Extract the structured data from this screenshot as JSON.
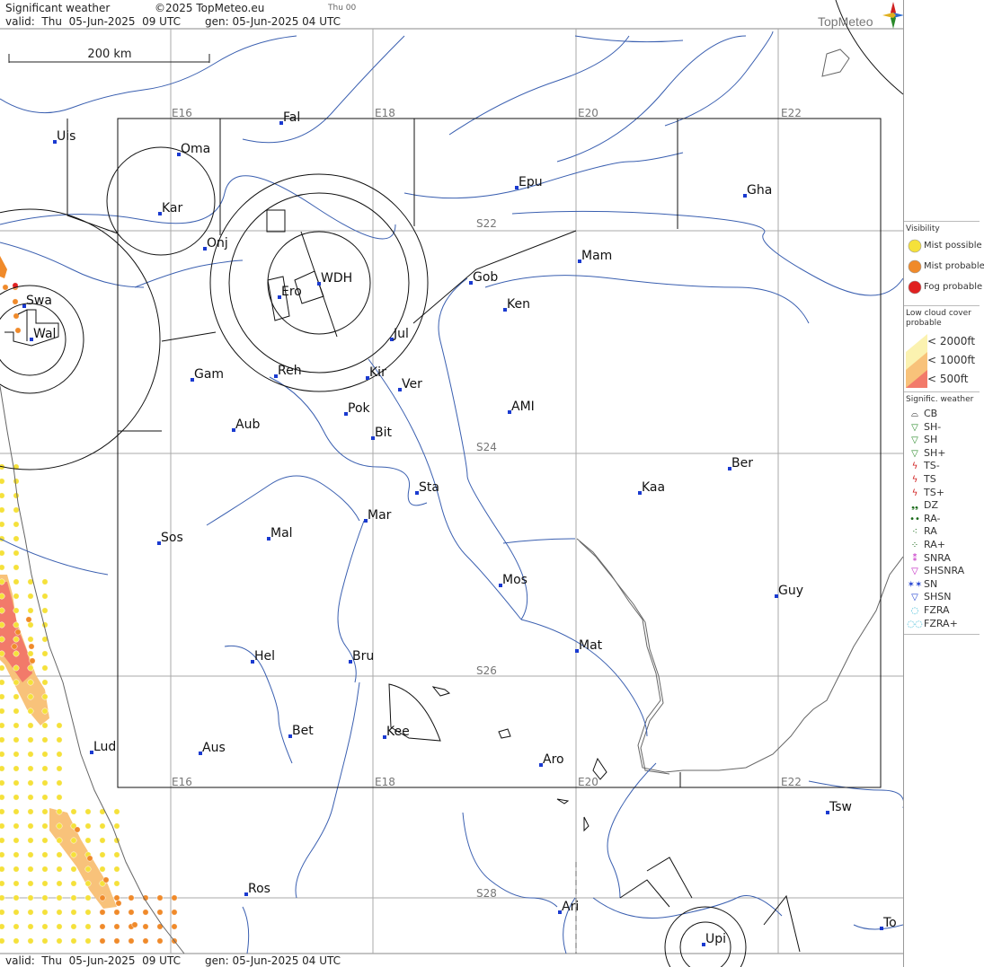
{
  "header": {
    "title": "Significant weather",
    "copyright": "©2025 TopMeteo.eu",
    "day_code": "Thu 00",
    "valid": "valid:  Thu  05-Jun-2025  09 UTC",
    "gen": "gen: 05-Jun-2025 04 UTC",
    "logo": "TopMeteo"
  },
  "footer": {
    "valid": "valid:  Thu  05-Jun-2025  09 UTC",
    "gen": "gen: 05-Jun-2025 04 UTC"
  },
  "scale_bar": {
    "label": "200 km"
  },
  "grid": {
    "lon_labels": [
      "E16",
      "E18",
      "E20",
      "E22"
    ],
    "lat_labels": [
      "S22",
      "S24",
      "S26",
      "S28"
    ]
  },
  "places": [
    {
      "name": "Uis"
    },
    {
      "name": "Fal"
    },
    {
      "name": "Oma"
    },
    {
      "name": "Kar"
    },
    {
      "name": "Epu"
    },
    {
      "name": "Gha"
    },
    {
      "name": "Onj"
    },
    {
      "name": "Mam"
    },
    {
      "name": "Gob"
    },
    {
      "name": "WDH"
    },
    {
      "name": "Swa"
    },
    {
      "name": "Ero"
    },
    {
      "name": "Ken"
    },
    {
      "name": "Wal"
    },
    {
      "name": "Jul"
    },
    {
      "name": "Gam"
    },
    {
      "name": "Reh"
    },
    {
      "name": "Kir"
    },
    {
      "name": "Ver"
    },
    {
      "name": "AMI"
    },
    {
      "name": "Pok"
    },
    {
      "name": "Aub"
    },
    {
      "name": "Bit"
    },
    {
      "name": "Ber"
    },
    {
      "name": "Sta"
    },
    {
      "name": "Kaa"
    },
    {
      "name": "Mar"
    },
    {
      "name": "Sos"
    },
    {
      "name": "Mal"
    },
    {
      "name": "Mos"
    },
    {
      "name": "Guy"
    },
    {
      "name": "Mat"
    },
    {
      "name": "Hel"
    },
    {
      "name": "Bru"
    },
    {
      "name": "Bet"
    },
    {
      "name": "Kee"
    },
    {
      "name": "Lud"
    },
    {
      "name": "Aus"
    },
    {
      "name": "Aro"
    },
    {
      "name": "Tsw"
    },
    {
      "name": "Ros"
    },
    {
      "name": "Ari"
    },
    {
      "name": "To"
    },
    {
      "name": "Upi"
    }
  ],
  "legend": {
    "visibility_title": "Visibility",
    "visibility": [
      {
        "label": "Mist possible",
        "icon": "mist-possible-icon",
        "color": "#f5e13a"
      },
      {
        "label": "Mist probable",
        "icon": "mist-probable-icon",
        "color": "#f08a2a"
      },
      {
        "label": "Fog probable",
        "icon": "fog-probable-icon",
        "color": "#e02020"
      }
    ],
    "low_cloud_title": "Low cloud cover probable",
    "low_cloud": [
      {
        "label": "< 2000ft",
        "color": "#fbf2b0"
      },
      {
        "label": "< 1000ft",
        "color": "#f8c27a"
      },
      {
        "label": "<   500ft",
        "color": "#f27a6a"
      }
    ],
    "sigwx_title": "Signific. weather",
    "sigwx": [
      {
        "label": "CB",
        "symbol": "⌓",
        "color": "#222222"
      },
      {
        "label": "SH-",
        "symbol": "▽",
        "color": "#2a8a2a"
      },
      {
        "label": "SH",
        "symbol": "▽",
        "color": "#2a8a2a"
      },
      {
        "label": "SH+",
        "symbol": "▽",
        "color": "#2a8a2a"
      },
      {
        "label": "TS-",
        "symbol": "ϟ",
        "color": "#d02020"
      },
      {
        "label": "TS",
        "symbol": "ϟ",
        "color": "#d02020"
      },
      {
        "label": "TS+",
        "symbol": "ϟ",
        "color": "#d02020"
      },
      {
        "label": "DZ",
        "symbol": "❟❟",
        "color": "#1a6a1a"
      },
      {
        "label": "RA-",
        "symbol": "••",
        "color": "#1a6a1a"
      },
      {
        "label": "RA",
        "symbol": "⁖",
        "color": "#1a6a1a"
      },
      {
        "label": "RA+",
        "symbol": "⁘",
        "color": "#1a6a1a"
      },
      {
        "label": "SNRA",
        "symbol": "⁑",
        "color": "#c020c0"
      },
      {
        "label": "SHSNRA",
        "symbol": "▽",
        "color": "#c020c0"
      },
      {
        "label": "SN",
        "symbol": "✶✶",
        "color": "#2040d0"
      },
      {
        "label": "SHSN",
        "symbol": "▽",
        "color": "#2040d0"
      },
      {
        "label": "FZRA",
        "symbol": "◌",
        "color": "#20b0d0"
      },
      {
        "label": "FZRA+",
        "symbol": "◌◌",
        "color": "#20b0d0"
      }
    ]
  }
}
